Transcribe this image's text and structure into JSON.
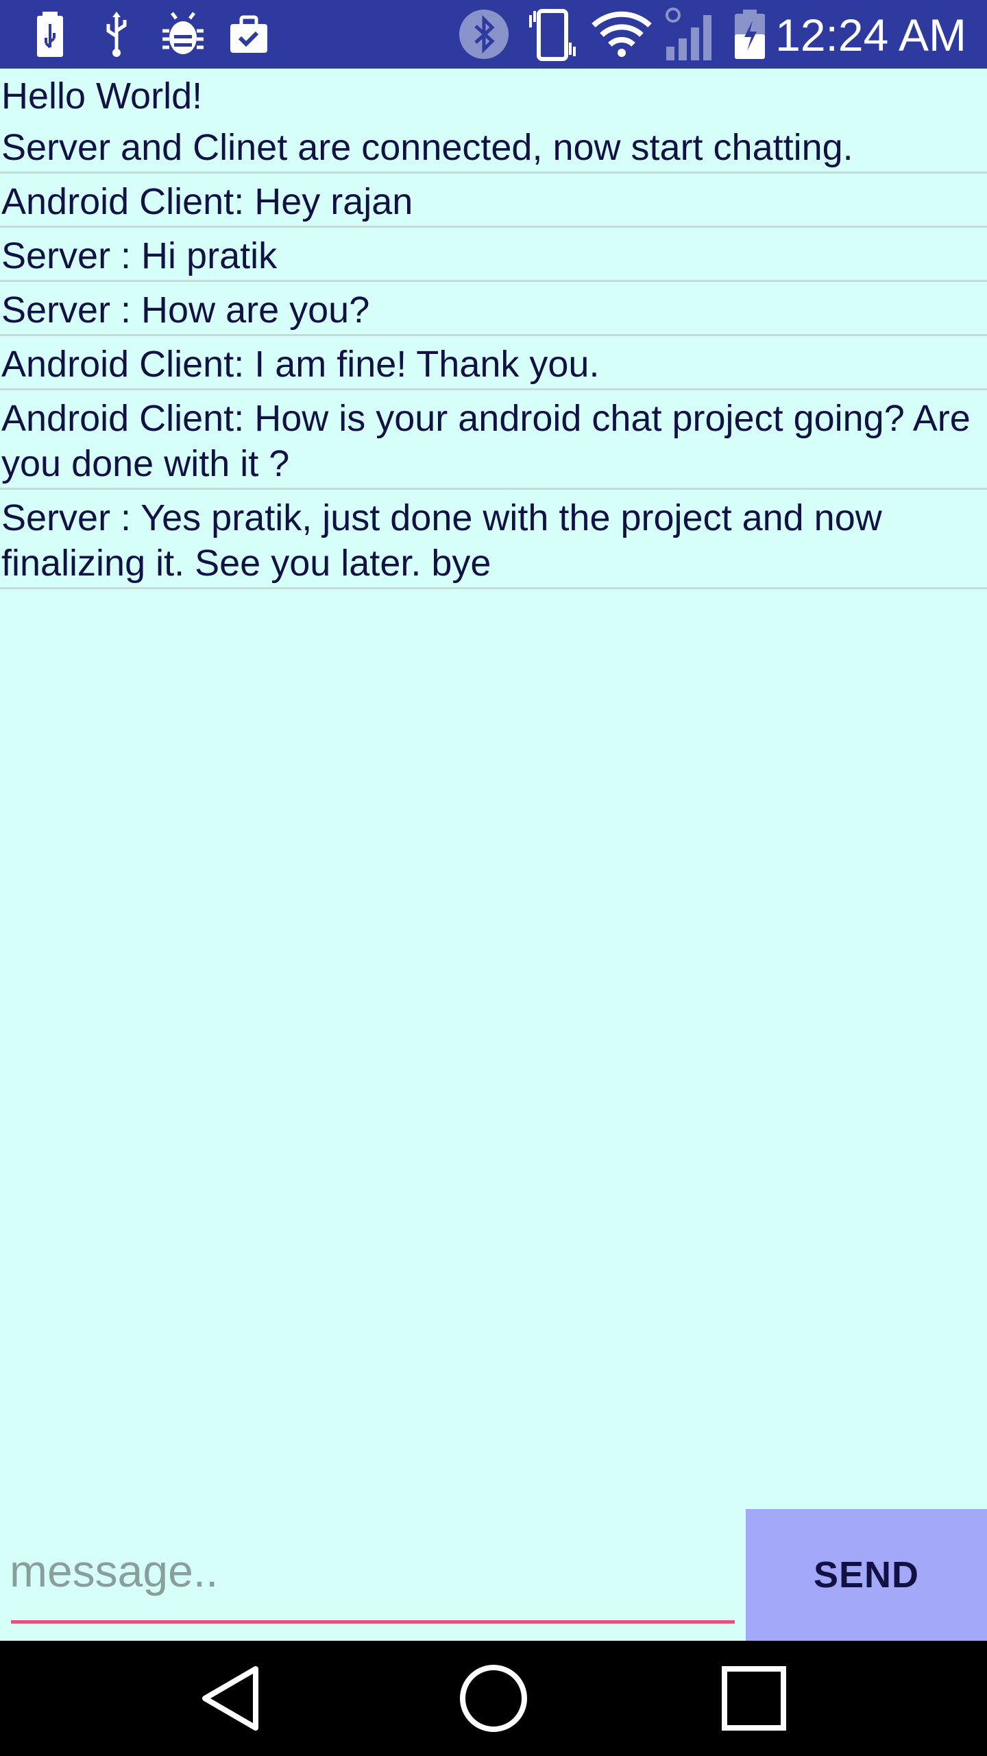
{
  "status_bar": {
    "time": "12:24 AM",
    "left_icons": [
      "battery-usb-icon",
      "usb-icon",
      "debug-bug-icon",
      "work-briefcase-icon"
    ],
    "right_icons": [
      "bluetooth-icon",
      "vibrate-icon",
      "wifi-icon",
      "cellular-signal-icon",
      "battery-charging-icon"
    ],
    "colors": {
      "background": "#2e3a9e",
      "foreground": "#ffffff"
    }
  },
  "chat": {
    "greeting": "Hello World!",
    "messages": [
      "Server and Clinet are connected, now start chatting.",
      "Android Client: Hey rajan",
      "Server : Hi pratik",
      "Server : How are you?",
      "Android Client: I am fine! Thank you.",
      "Android Client: How is your android chat project going? Are you done with it ?",
      "Server : Yes pratik, just done with the project and now finalizing it. See you later. bye"
    ],
    "colors": {
      "background": "#d6fff9",
      "text": "#111144",
      "divider": "#c3dcd7"
    }
  },
  "composer": {
    "placeholder": "message..",
    "value": "",
    "send_label": "SEND",
    "colors": {
      "send_background": "#a3a8f8",
      "underline": "#e0557a"
    }
  },
  "nav_bar": {
    "buttons": [
      "back-icon",
      "home-icon",
      "recents-icon"
    ],
    "colors": {
      "background": "#000000",
      "foreground": "#ffffff"
    }
  }
}
